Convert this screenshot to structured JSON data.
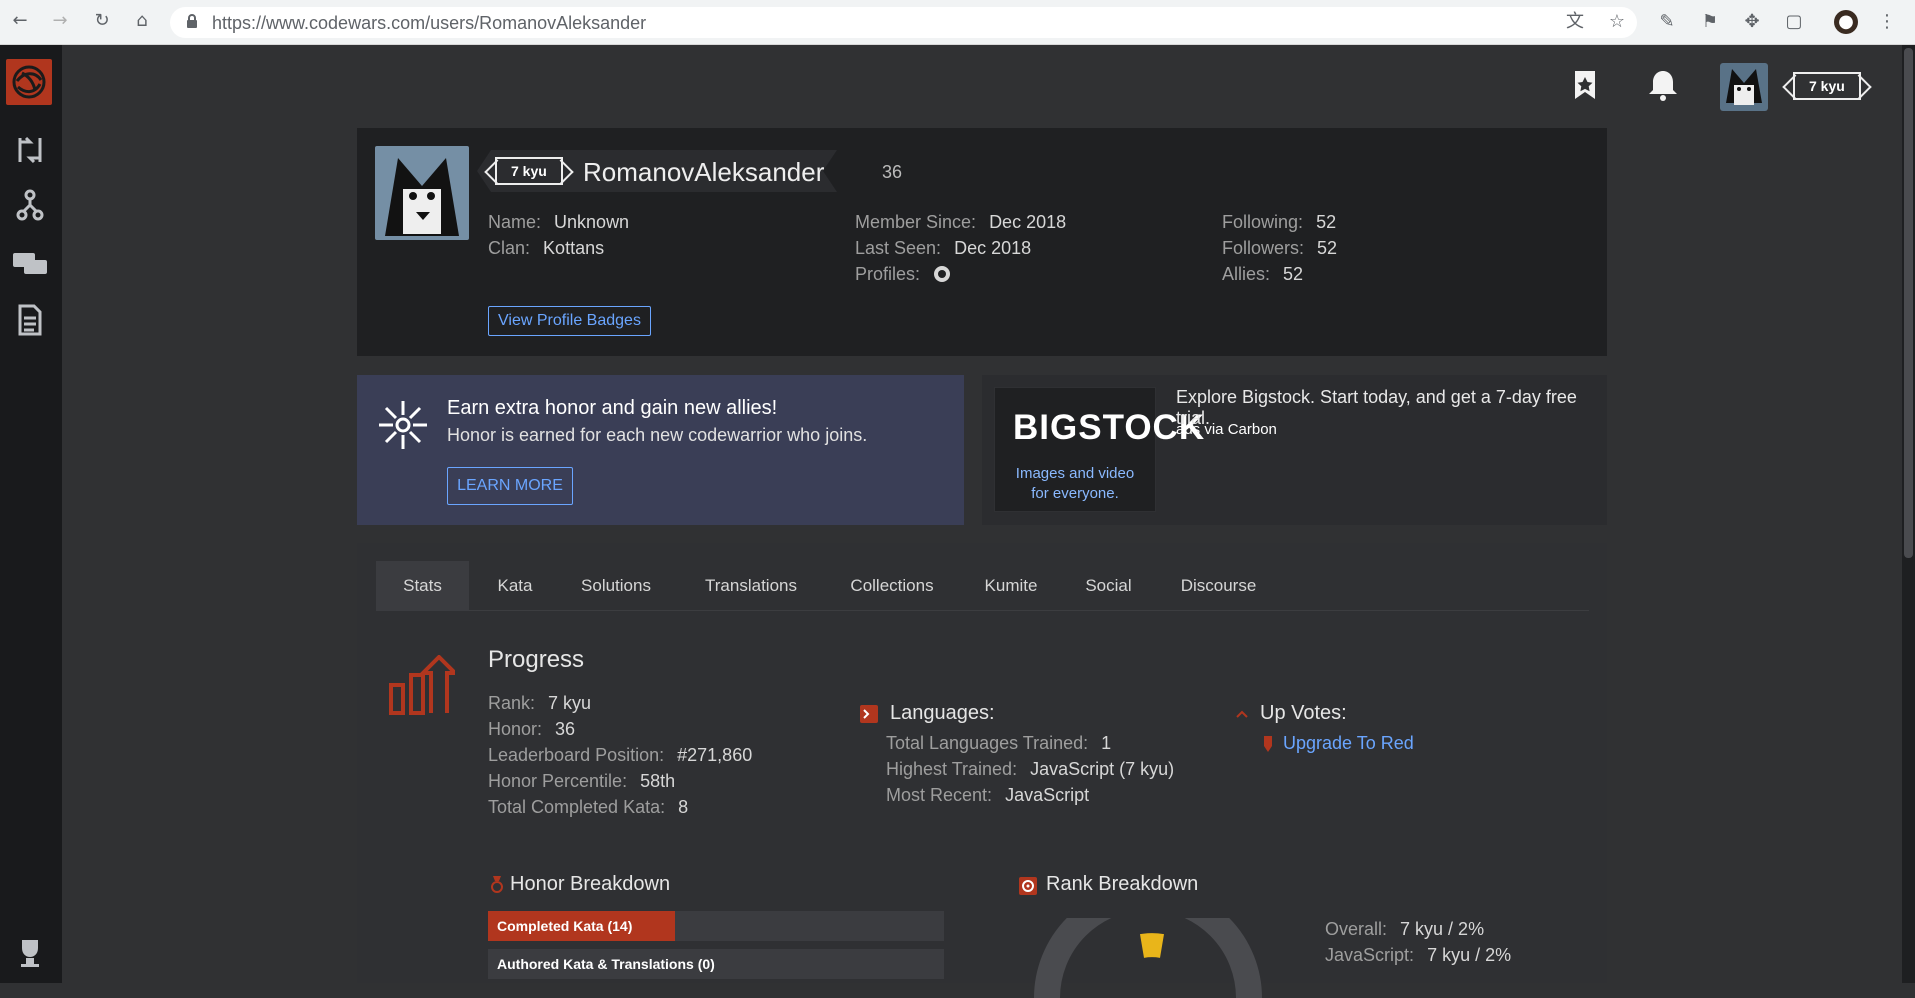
{
  "browser": {
    "url": "https://www.codewars.com/users/RomanovAleksander"
  },
  "header": {
    "rank": "7 kyu",
    "honor": "36"
  },
  "profile": {
    "rank": "7 kyu",
    "username": "RomanovAleksander",
    "honor": "36",
    "fields": {
      "name_k": "Name:",
      "name_v": "Unknown",
      "clan_k": "Clan:",
      "clan_v": "Kottans",
      "member_k": "Member Since:",
      "member_v": "Dec 2018",
      "seen_k": "Last Seen:",
      "seen_v": "Dec 2018",
      "profiles_k": "Profiles:",
      "following_k": "Following:",
      "following_v": "52",
      "followers_k": "Followers:",
      "followers_v": "52",
      "allies_k": "Allies:",
      "allies_v": "52"
    },
    "view_badges": "View Profile Badges"
  },
  "promo": {
    "title": "Earn extra honor and gain new allies!",
    "subtitle": "Honor is earned for each new codewarrior who joins.",
    "button": "LEARN MORE"
  },
  "carbon": {
    "logo": "BIGSTOCK",
    "caption1": "Images and video",
    "caption2": "for everyone.",
    "text": "Explore Bigstock. Start today, and get a 7-day free trial.",
    "via": "ads via Carbon"
  },
  "tabs": [
    "Stats",
    "Kata",
    "Solutions",
    "Translations",
    "Collections",
    "Kumite",
    "Social",
    "Discourse"
  ],
  "stats": {
    "progress_title": "Progress",
    "rank_k": "Rank:",
    "rank_v": "7 kyu",
    "honor_k": "Honor:",
    "honor_v": "36",
    "leader_k": "Leaderboard Position:",
    "leader_v": "#271,860",
    "percent_k": "Honor Percentile:",
    "percent_v": "58th",
    "completed_k": "Total Completed Kata:",
    "completed_v": "8",
    "languages_title": "Languages:",
    "lang_total_k": "Total Languages Trained:",
    "lang_total_v": "1",
    "lang_high_k": "Highest Trained:",
    "lang_high_v": "JavaScript (7 kyu)",
    "lang_recent_k": "Most Recent:",
    "lang_recent_v": "JavaScript",
    "upvotes_title": "Up Votes:",
    "upvotes_link": "Upgrade To Red",
    "honor_breakdown_title": "Honor Breakdown",
    "honor_bars": [
      {
        "label": "Completed Kata (14)",
        "fraction": 0.41
      },
      {
        "label": "Authored Kata & Translations (0)",
        "fraction": 0
      }
    ],
    "rank_breakdown_title": "Rank Breakdown",
    "overall_k": "Overall:",
    "overall_v": "7 kyu / 2%",
    "js_k": "JavaScript:",
    "js_v": "7 kyu / 2%"
  },
  "colors": {
    "accent_red": "#b1361e",
    "link_blue": "#6aa5ff",
    "promo_bg": "#3a3e56",
    "rank_yellow": "#e9b51a"
  }
}
